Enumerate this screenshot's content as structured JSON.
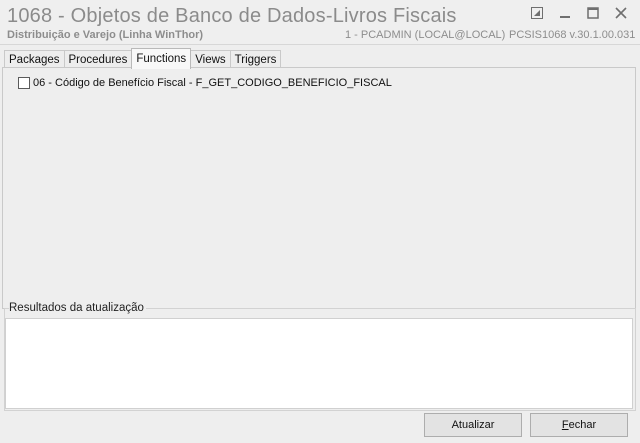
{
  "window": {
    "title": "1068 - Objetos de Banco de Dados-Livros Fiscais",
    "subtitle": "Distribuição e Varejo (Linha WinThor)",
    "user_info": "1 - PCADMIN (LOCAL@LOCAL)",
    "system_info": "PCSIS1068  v.30.1.00.031",
    "controls": [
      "restore-icon",
      "minimize-icon",
      "maximize-icon",
      "close-icon"
    ]
  },
  "tabs": [
    {
      "label": "Packages",
      "active": false
    },
    {
      "label": "Procedures",
      "active": false
    },
    {
      "label": "Functions",
      "active": true
    },
    {
      "label": "Views",
      "active": false
    },
    {
      "label": "Triggers",
      "active": false
    }
  ],
  "functions": {
    "items": [
      {
        "label": "06 - Código de Benefício Fiscal - F_GET_CODIGO_BENEFICIO_FISCAL",
        "checked": false
      }
    ]
  },
  "results": {
    "label": "Resultados da atualização",
    "content": ""
  },
  "buttons": {
    "update": "Atualizar",
    "close_mnemonic": "F",
    "close_rest": "echar"
  }
}
